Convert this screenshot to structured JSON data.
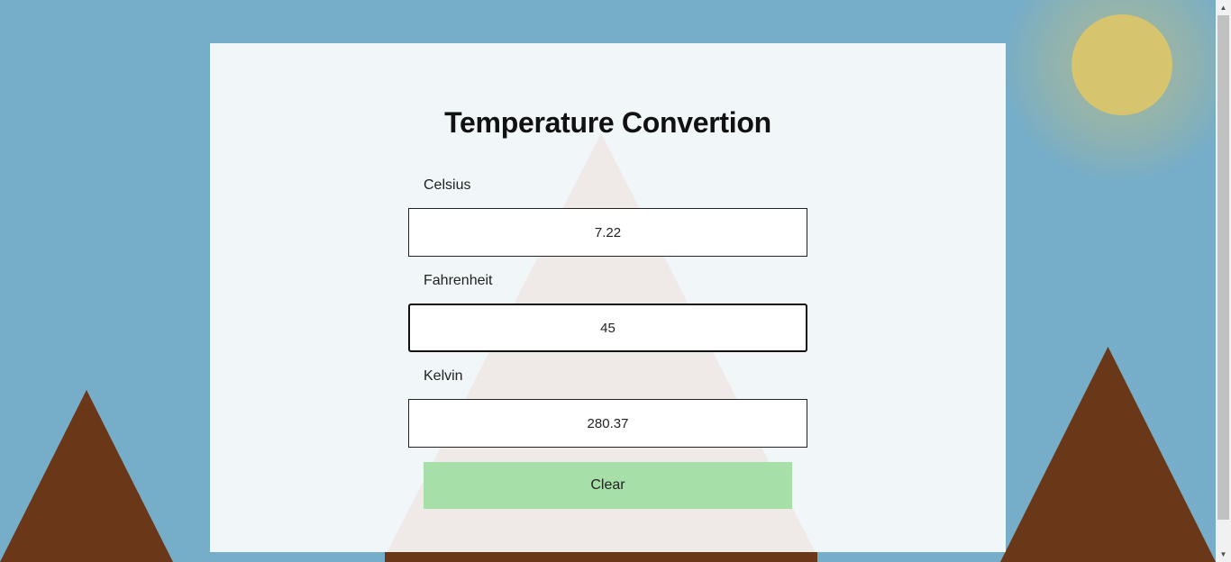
{
  "form": {
    "title": "Temperature Convertion",
    "celsius": {
      "label": "Celsius",
      "value": "7.22"
    },
    "fahrenheit": {
      "label": "Fahrenheit",
      "value": "45"
    },
    "kelvin": {
      "label": "Kelvin",
      "value": "280.37"
    },
    "clear_label": "Clear"
  },
  "scrollbar": {
    "up_arrow": "▲",
    "down_arrow": "▼"
  },
  "colors": {
    "sky": "#76adc8",
    "sun": "#d6c46f",
    "mountain": "#6b3719",
    "panel": "#f1f6f9",
    "snow_peak": "#efe9e7",
    "clear_button": "#a6dfa8"
  }
}
